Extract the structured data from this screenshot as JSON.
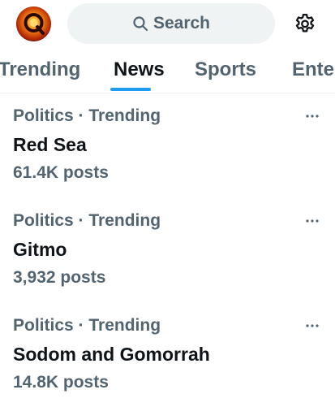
{
  "header": {
    "search_label": "Search",
    "avatar_icon": "q-logo-avatar",
    "search_icon": "search-icon",
    "settings_icon": "gear-icon"
  },
  "tabs": [
    {
      "label": "Trending",
      "active": false
    },
    {
      "label": "News",
      "active": true
    },
    {
      "label": "Sports",
      "active": false
    },
    {
      "label": "Ente",
      "active": false
    }
  ],
  "trends": [
    {
      "context": "Politics · Trending",
      "name": "Red Sea",
      "count": "61.4K posts"
    },
    {
      "context": "Politics · Trending",
      "name": "Gitmo",
      "count": "3,932 posts"
    },
    {
      "context": "Politics · Trending",
      "name": "Sodom and Gomorrah",
      "count": "14.8K posts"
    }
  ],
  "colors": {
    "accent": "#1d9bf0",
    "primary_text": "#0f1419",
    "secondary_text": "#536471",
    "search_bg": "#eff3f4"
  }
}
